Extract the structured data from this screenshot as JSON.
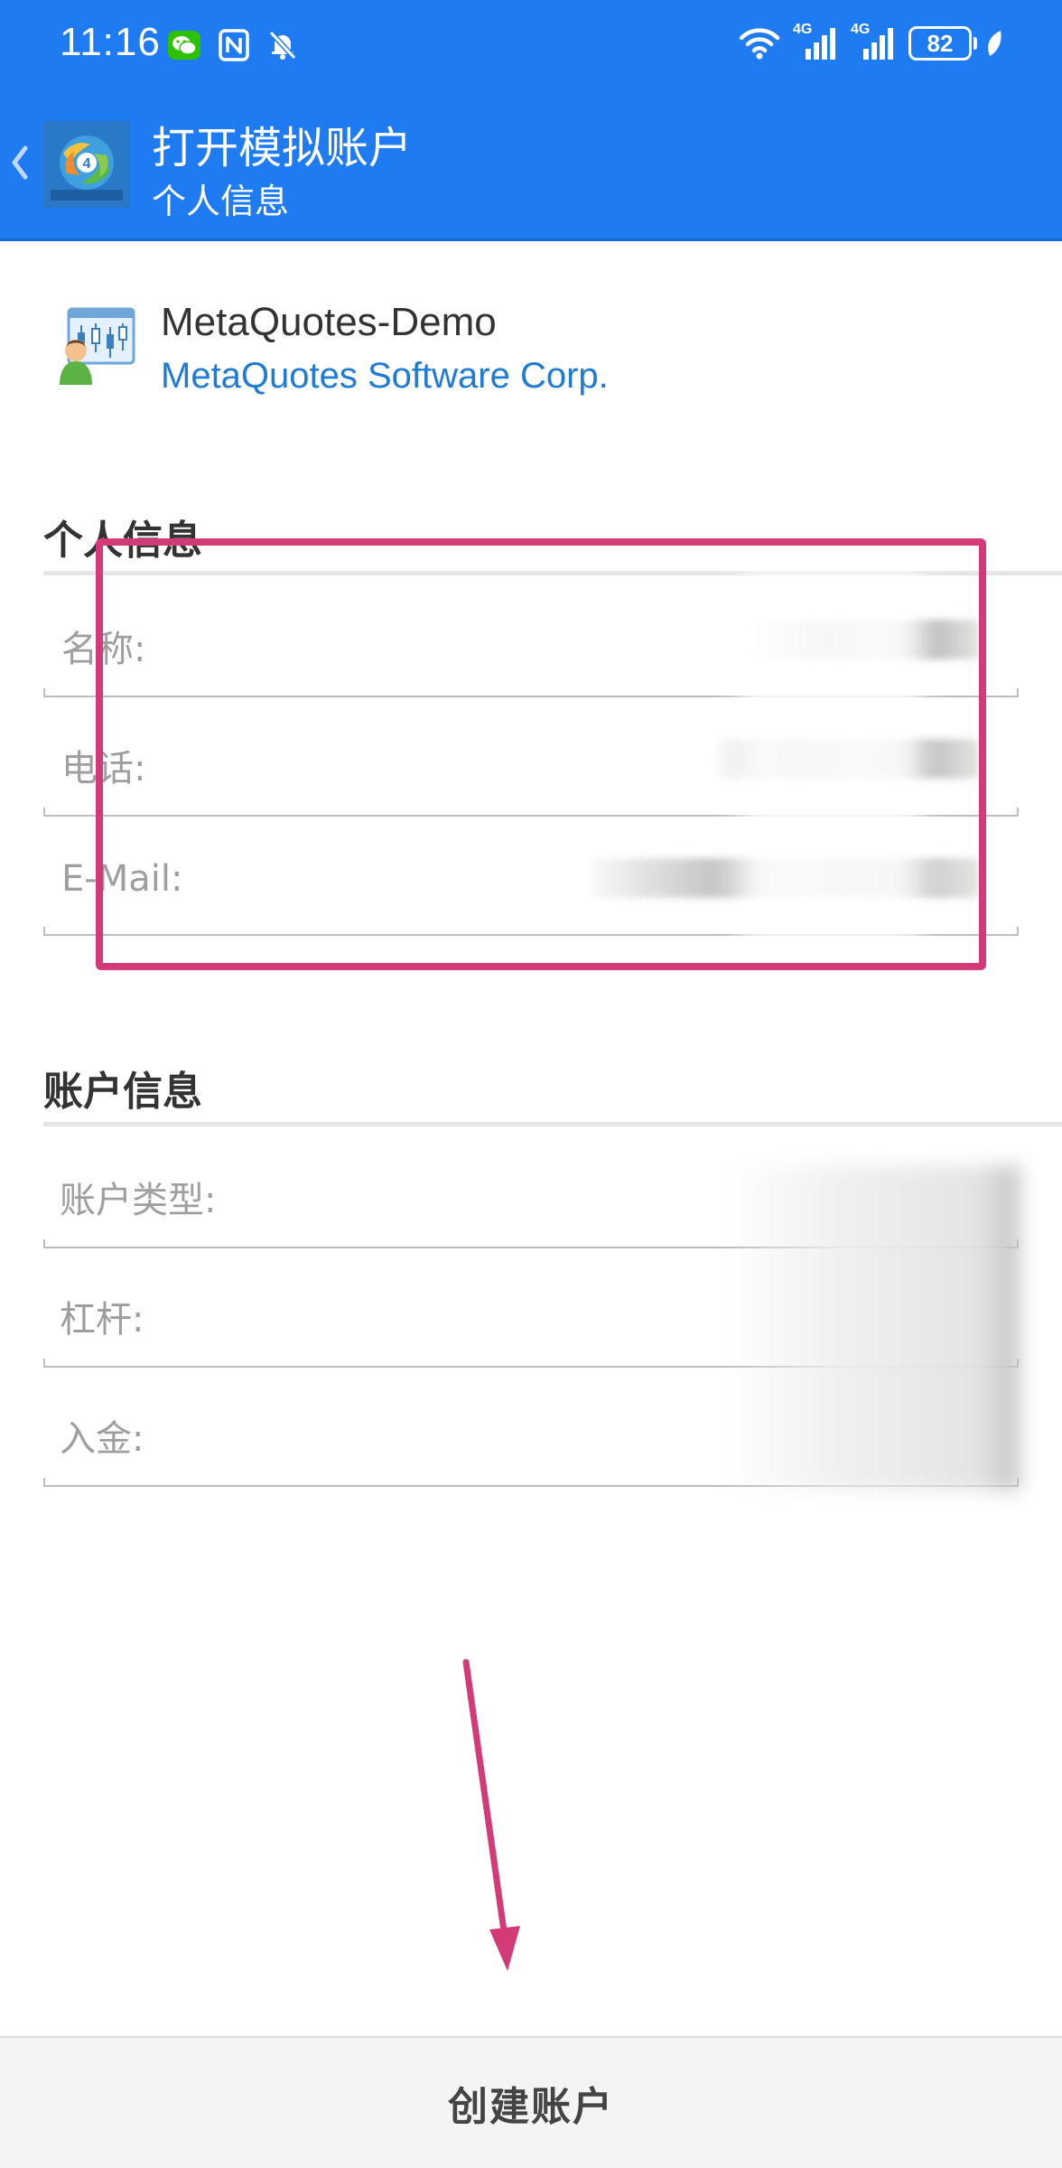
{
  "status_bar": {
    "time": "11:16",
    "battery": "82",
    "network_1": "4G",
    "network_2": "4G"
  },
  "appbar": {
    "title": "打开模拟账户",
    "subtitle": "个人信息"
  },
  "server": {
    "name": "MetaQuotes-Demo",
    "company": "MetaQuotes Software Corp."
  },
  "personal_info": {
    "title": "个人信息",
    "fields": [
      {
        "label": "名称:"
      },
      {
        "label": "电话:"
      },
      {
        "label": "E-Mail:"
      }
    ]
  },
  "account_info": {
    "title": "账户信息",
    "fields": [
      {
        "label": "账户类型:"
      },
      {
        "label": "杠杆:"
      },
      {
        "label": "入金:"
      }
    ]
  },
  "bottom": {
    "create_button_label": "创建账户"
  },
  "colors": {
    "appbar": "#1E7BF2",
    "link": "#1E7BD6",
    "annotation": "#D33A78"
  }
}
